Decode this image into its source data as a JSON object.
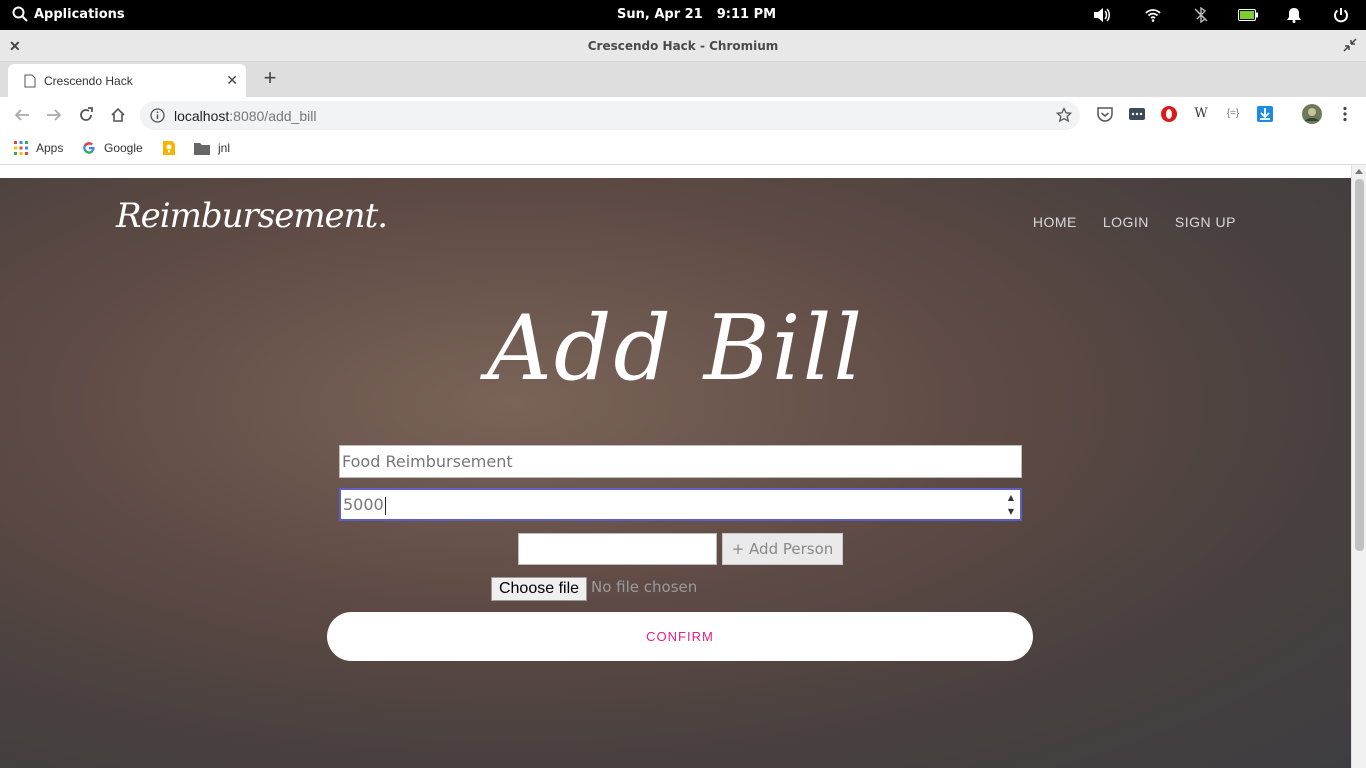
{
  "system_bar": {
    "applications_label": "Applications",
    "date": "Sun, Apr 21",
    "time": "9:11 PM"
  },
  "window": {
    "title": "Crescendo Hack - Chromium"
  },
  "tab": {
    "title": "Crescendo Hack"
  },
  "address_bar": {
    "host": "localhost",
    "path": ":8080/add_bill"
  },
  "bookmarks": [
    {
      "label": "Apps",
      "icon": "apps-grid-icon"
    },
    {
      "label": "Google",
      "icon": "google-icon"
    },
    {
      "label": "",
      "icon": "keep-icon"
    },
    {
      "label": "jnl",
      "icon": "folder-icon"
    }
  ],
  "site": {
    "brand": "Reimbursement.",
    "nav": [
      "HOME",
      "LOGIN",
      "SIGN UP"
    ]
  },
  "form": {
    "heading": "Add Bill",
    "bill_name_value": "Food Reimbursement",
    "amount_value": "5000",
    "person_value": "",
    "add_person_label": "+ Add Person",
    "choose_file_label": "Choose file",
    "file_status": "No file chosen",
    "confirm_label": "CONFIRM"
  },
  "colors": {
    "accent": "#e0208c",
    "focus_border": "#5b5fc7"
  }
}
